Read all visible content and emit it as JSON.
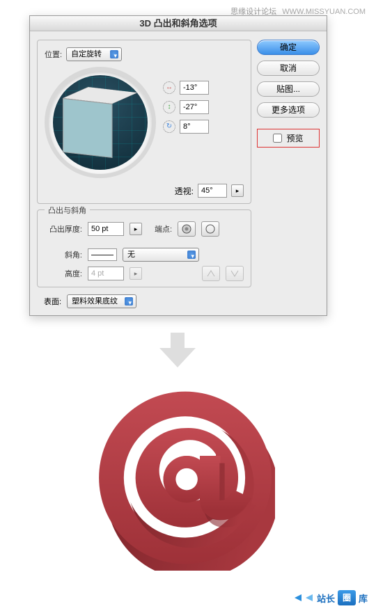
{
  "watermark": {
    "name": "思缘设计论坛",
    "url": "WWW.MISSYUAN.COM"
  },
  "dialog": {
    "title": "3D 凸出和斜角选项",
    "position": {
      "label": "位置:",
      "value": "自定旋转"
    },
    "angles": {
      "x": "-13°",
      "y": "-27°",
      "z": "8°"
    },
    "perspective": {
      "label": "透视:",
      "value": "45°"
    },
    "extrude_section": {
      "legend": "凸出与斜角",
      "depth_label": "凸出厚度:",
      "depth_value": "50 pt",
      "cap_label": "端点:",
      "bevel_label": "斜角:",
      "bevel_value": "无",
      "height_label": "高度:",
      "height_value": "4 pt"
    },
    "surface": {
      "label": "表面:",
      "value": "塑料效果底纹"
    },
    "buttons": {
      "ok": "确定",
      "cancel": "取消",
      "map": "贴图...",
      "more": "更多选项"
    },
    "preview": {
      "label": "预览"
    }
  },
  "footer": {
    "brand_pre": "站长",
    "brand_post": "库"
  }
}
